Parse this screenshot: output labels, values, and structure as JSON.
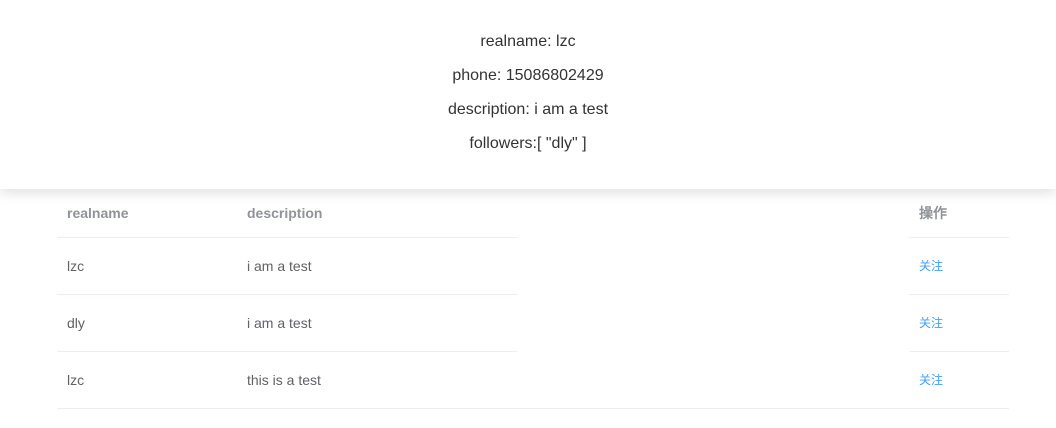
{
  "profile": {
    "realname": "realname: lzc",
    "phone": "phone: 15086802429",
    "description": "description: i am a test",
    "followers": "followers:[ \"dly\" ]"
  },
  "table": {
    "headers": {
      "realname": "realname",
      "description": "description",
      "operation": "操作"
    },
    "rows": [
      {
        "realname": "lzc",
        "description": "i am a test",
        "action": "关注"
      },
      {
        "realname": "dly",
        "description": "i am a test",
        "action": "关注"
      },
      {
        "realname": "lzc",
        "description": "this is a test",
        "action": "关注"
      }
    ]
  },
  "colors": {
    "link": "#409eff",
    "header_text": "#909399",
    "cell_text": "#606266",
    "border": "#ebeef5"
  }
}
